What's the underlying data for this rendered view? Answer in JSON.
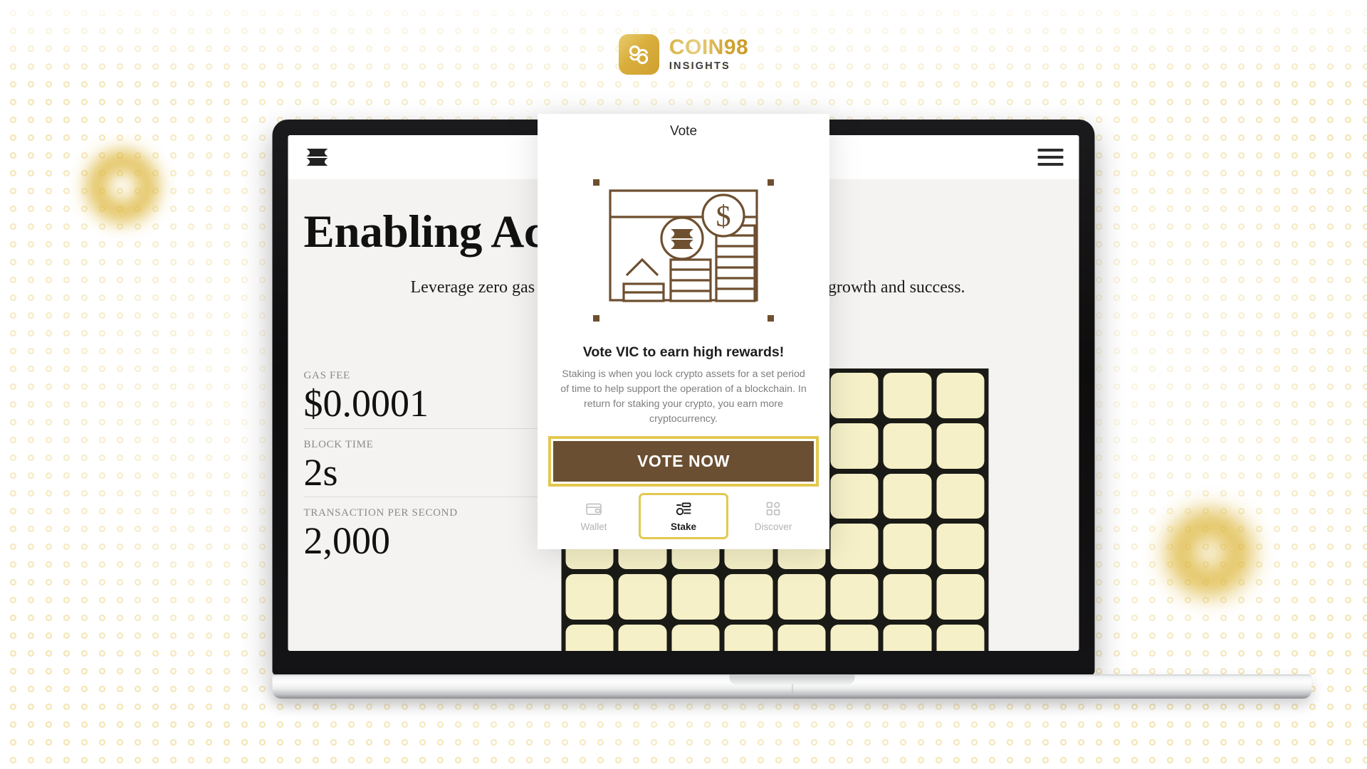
{
  "brand": {
    "logo_icon": "coin98-logo-icon",
    "name": "COIN98",
    "subtitle": "INSIGHTS"
  },
  "website": {
    "nav": {
      "logo_icon": "viction-logo-icon",
      "menu_icon": "hamburger-menu-icon"
    },
    "hero": {
      "title": "Enabling Achievement",
      "subtitle": "Leverage zero gas fee, speed and security to build and foster growth and success."
    },
    "stats": [
      {
        "label": "GAS FEE",
        "value": "$0.0001"
      },
      {
        "label": "BLOCK TIME",
        "value": "2s"
      },
      {
        "label": "TRANSACTION PER SECOND",
        "value": "2,000"
      }
    ],
    "tile_grid": {
      "columns": 8,
      "rows": 6,
      "tile_color": "#f5f0c7",
      "background": "#1a1a16"
    }
  },
  "phone_modal": {
    "header_title": "Vote",
    "illustration_icon": "stake-chart-illustration",
    "headline": "Vote VIC to earn high rewards!",
    "description": "Staking is when you lock crypto assets for a set period of time to help support the operation of a blockchain. In return for staking your crypto, you earn more cryptocurrency.",
    "primary_button": "VOTE NOW",
    "tabs": [
      {
        "label": "Wallet",
        "icon": "wallet-icon",
        "active": false
      },
      {
        "label": "Stake",
        "icon": "stake-icon",
        "active": true
      },
      {
        "label": "Discover",
        "icon": "discover-grid-icon",
        "active": false
      }
    ]
  },
  "colors": {
    "brand_gold": "#d9ae3c",
    "accent_yellow": "#e3c84f",
    "brown": "#6b4f32",
    "tile_cream": "#f5f0c7",
    "site_bg": "#f4f3f1"
  }
}
